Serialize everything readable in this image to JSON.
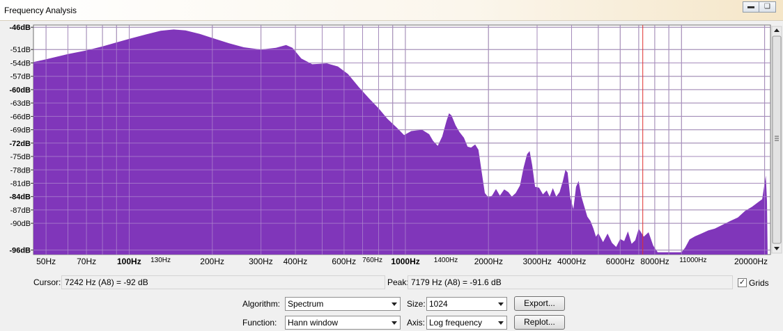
{
  "window": {
    "title": "Frequency Analysis"
  },
  "titlebar_buttons": {
    "minimize_icon": "minimize-icon",
    "maximize_icon": "maximize-icon"
  },
  "cursor": {
    "label": "Cursor:",
    "value": "7242 Hz (A8) = -92 dB",
    "freq_hz": 7242
  },
  "peak": {
    "label": "Peak:",
    "value": "7179 Hz (A8) = -91.6 dB"
  },
  "grids": {
    "label": "Grids",
    "checked": true
  },
  "algorithm": {
    "label": "Algorithm:",
    "value": "Spectrum"
  },
  "function": {
    "label": "Function:",
    "value": "Hann window"
  },
  "size": {
    "label": "Size:",
    "value": "1024"
  },
  "axis": {
    "label": "Axis:",
    "value": "Log frequency"
  },
  "buttons": {
    "export": "Export...",
    "replot": "Replot..."
  },
  "colors": {
    "fill": "#8036BA",
    "cursor_line": "#E0302F",
    "grid": "#8a8a8a"
  },
  "chart_data": {
    "type": "area",
    "x_scale": "log",
    "xlim": [
      45,
      21000
    ],
    "ylim": [
      -97,
      -45.5
    ],
    "grid": true,
    "y_ticks": [
      {
        "v": -46,
        "t": "-46dB",
        "b": true
      },
      {
        "v": -51,
        "t": "-51dB"
      },
      {
        "v": -54,
        "t": "-54dB"
      },
      {
        "v": -57,
        "t": "-57dB"
      },
      {
        "v": -60,
        "t": "-60dB",
        "b": true
      },
      {
        "v": -63,
        "t": "-63dB"
      },
      {
        "v": -66,
        "t": "-66dB"
      },
      {
        "v": -69,
        "t": "-69dB"
      },
      {
        "v": -72,
        "t": "-72dB",
        "b": true
      },
      {
        "v": -75,
        "t": "-75dB"
      },
      {
        "v": -78,
        "t": "-78dB"
      },
      {
        "v": -81,
        "t": "-81dB"
      },
      {
        "v": -84,
        "t": "-84dB",
        "b": true
      },
      {
        "v": -87,
        "t": "-87dB"
      },
      {
        "v": -90,
        "t": "-90dB"
      },
      {
        "v": -96,
        "t": "-96dB",
        "b": true
      }
    ],
    "x_ticks": [
      {
        "v": 50,
        "t": "50Hz"
      },
      {
        "v": 70,
        "t": "70Hz"
      },
      {
        "v": 100,
        "t": "100Hz",
        "b": true
      },
      {
        "v": 130,
        "t": "130Hz",
        "s": true
      },
      {
        "v": 200,
        "t": "200Hz"
      },
      {
        "v": 300,
        "t": "300Hz"
      },
      {
        "v": 400,
        "t": "400Hz"
      },
      {
        "v": 600,
        "t": "600Hz"
      },
      {
        "v": 760,
        "t": "760Hz",
        "s": true
      },
      {
        "v": 1000,
        "t": "1000Hz",
        "b": true
      },
      {
        "v": 1400,
        "t": "1400Hz",
        "s": true
      },
      {
        "v": 2000,
        "t": "2000Hz"
      },
      {
        "v": 3000,
        "t": "3000Hz"
      },
      {
        "v": 4000,
        "t": "4000Hz"
      },
      {
        "v": 6000,
        "t": "6000Hz"
      },
      {
        "v": 8000,
        "t": "8000Hz"
      },
      {
        "v": 11000,
        "t": "11000Hz",
        "s": true
      },
      {
        "v": 20000,
        "t": "20000Hz"
      }
    ],
    "x_grid": [
      50,
      60,
      70,
      80,
      90,
      100,
      200,
      300,
      400,
      500,
      600,
      700,
      800,
      900,
      1000,
      2000,
      3000,
      4000,
      5000,
      6000,
      7000,
      8000,
      9000,
      10000,
      20000
    ],
    "points": [
      [
        45,
        -53.8
      ],
      [
        50,
        -53.2
      ],
      [
        60,
        -52
      ],
      [
        70,
        -51.2
      ],
      [
        80,
        -50.3
      ],
      [
        90,
        -49.4
      ],
      [
        100,
        -48.6
      ],
      [
        115,
        -47.6
      ],
      [
        130,
        -46.8
      ],
      [
        145,
        -46.5
      ],
      [
        160,
        -46.7
      ],
      [
        180,
        -47.5
      ],
      [
        200,
        -48.4
      ],
      [
        230,
        -49.6
      ],
      [
        260,
        -50.5
      ],
      [
        300,
        -51
      ],
      [
        340,
        -50.6
      ],
      [
        370,
        -50
      ],
      [
        390,
        -50.6
      ],
      [
        420,
        -53
      ],
      [
        460,
        -54.3
      ],
      [
        520,
        -54.1
      ],
      [
        570,
        -54.8
      ],
      [
        620,
        -56.5
      ],
      [
        680,
        -59.5
      ],
      [
        740,
        -62
      ],
      [
        800,
        -64.2
      ],
      [
        860,
        -66.5
      ],
      [
        930,
        -68.5
      ],
      [
        990,
        -70.2
      ],
      [
        1050,
        -69.3
      ],
      [
        1150,
        -69
      ],
      [
        1220,
        -70
      ],
      [
        1260,
        -71.5
      ],
      [
        1310,
        -72.6
      ],
      [
        1360,
        -70.5
      ],
      [
        1410,
        -67
      ],
      [
        1440,
        -65.3
      ],
      [
        1470,
        -65.8
      ],
      [
        1520,
        -68
      ],
      [
        1570,
        -69.5
      ],
      [
        1630,
        -70.8
      ],
      [
        1680,
        -72.8
      ],
      [
        1730,
        -73
      ],
      [
        1790,
        -72.3
      ],
      [
        1840,
        -73.5
      ],
      [
        1890,
        -78.5
      ],
      [
        1940,
        -83.2
      ],
      [
        2000,
        -84.2
      ],
      [
        2060,
        -83.8
      ],
      [
        2130,
        -82.3
      ],
      [
        2200,
        -83.8
      ],
      [
        2280,
        -82.4
      ],
      [
        2360,
        -83
      ],
      [
        2430,
        -84
      ],
      [
        2510,
        -83.2
      ],
      [
        2600,
        -81.5
      ],
      [
        2680,
        -77.5
      ],
      [
        2760,
        -74.5
      ],
      [
        2820,
        -73.8
      ],
      [
        2880,
        -77
      ],
      [
        2950,
        -81.8
      ],
      [
        3050,
        -82
      ],
      [
        3150,
        -83.5
      ],
      [
        3250,
        -82.6
      ],
      [
        3330,
        -84
      ],
      [
        3420,
        -82.1
      ],
      [
        3520,
        -84
      ],
      [
        3620,
        -83
      ],
      [
        3720,
        -80.5
      ],
      [
        3800,
        -78
      ],
      [
        3870,
        -78.6
      ],
      [
        3950,
        -84
      ],
      [
        4060,
        -86.8
      ],
      [
        4150,
        -81.8
      ],
      [
        4240,
        -80.5
      ],
      [
        4340,
        -84
      ],
      [
        4450,
        -86.3
      ],
      [
        4560,
        -88.5
      ],
      [
        4680,
        -89.5
      ],
      [
        4800,
        -91.2
      ],
      [
        4900,
        -93
      ],
      [
        5000,
        -92.2
      ],
      [
        5200,
        -94.2
      ],
      [
        5400,
        -92.3
      ],
      [
        5600,
        -94.4
      ],
      [
        5800,
        -95.3
      ],
      [
        6000,
        -93.5
      ],
      [
        6200,
        -94
      ],
      [
        6400,
        -91.8
      ],
      [
        6600,
        -94.6
      ],
      [
        6800,
        -93.8
      ],
      [
        7000,
        -91.2
      ],
      [
        7300,
        -93
      ],
      [
        7600,
        -92
      ],
      [
        7900,
        -95
      ],
      [
        8200,
        -96.5
      ],
      [
        8500,
        -96.5
      ],
      [
        9000,
        -96.5
      ],
      [
        9500,
        -96.5
      ],
      [
        10000,
        -96.5
      ],
      [
        10300,
        -95.5
      ],
      [
        10700,
        -93.6
      ],
      [
        11200,
        -92.9
      ],
      [
        11800,
        -92.3
      ],
      [
        12500,
        -91.6
      ],
      [
        13200,
        -91.2
      ],
      [
        14000,
        -90.4
      ],
      [
        15000,
        -89.5
      ],
      [
        16000,
        -88.7
      ],
      [
        17000,
        -87.2
      ],
      [
        18000,
        -86.3
      ],
      [
        19000,
        -85.2
      ],
      [
        19600,
        -84.6
      ],
      [
        20000,
        -81
      ],
      [
        20200,
        -79.3
      ],
      [
        20400,
        -85
      ],
      [
        20500,
        -96.5
      ]
    ]
  }
}
